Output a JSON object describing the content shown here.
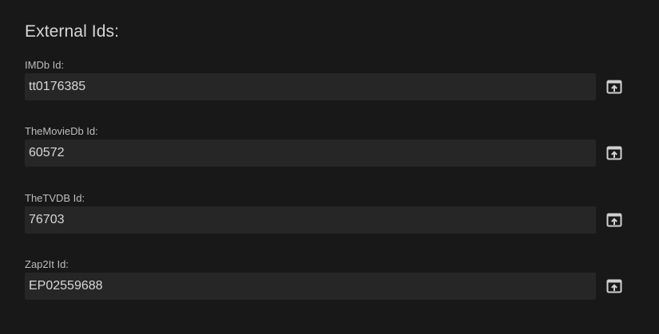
{
  "section": {
    "title": "External Ids:"
  },
  "fields": [
    {
      "label": "IMDb Id:",
      "value": "tt0176385",
      "button_icon": "open-external-icon"
    },
    {
      "label": "TheMovieDb Id:",
      "value": "60572",
      "button_icon": "open-external-icon"
    },
    {
      "label": "TheTVDB Id:",
      "value": "76703",
      "button_icon": "open-external-icon"
    },
    {
      "label": "Zap2It Id:",
      "value": "EP02559688",
      "button_icon": "open-external-icon"
    }
  ],
  "colors": {
    "background": "#181818",
    "input_background": "#262626",
    "text": "#d8d8d8",
    "label": "#bdbdbd"
  }
}
